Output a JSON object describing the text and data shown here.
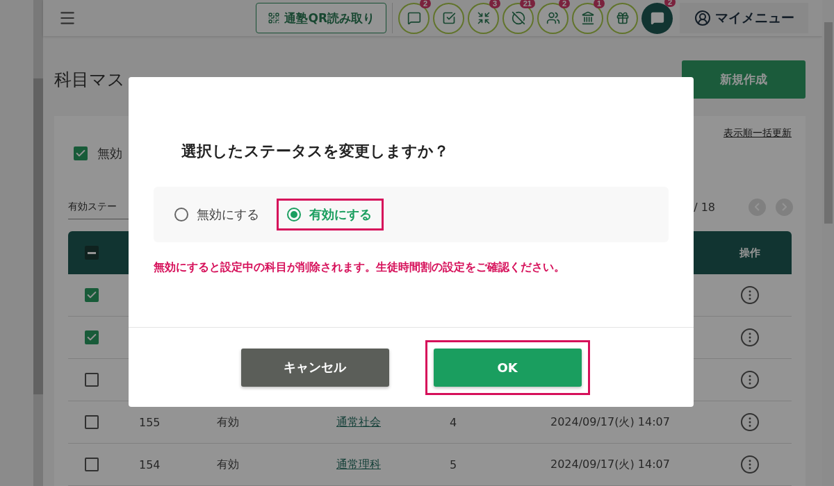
{
  "header": {
    "qr_button": "通塾QR読み取り",
    "icons": [
      {
        "badge": "2",
        "active": false
      },
      {
        "active": false
      },
      {
        "badge": "3",
        "active": false
      },
      {
        "badge": "21",
        "active": false
      },
      {
        "badge": "2",
        "active": false
      },
      {
        "badge": "1",
        "active": false
      },
      {
        "active": false
      },
      {
        "badge": "2",
        "active": true
      }
    ],
    "my_menu": "マイメニュー"
  },
  "page": {
    "title": "科目マス",
    "new_button": "新規作成"
  },
  "card": {
    "filter_checkbox": {
      "label": "無効",
      "checked": true
    },
    "filter_select": "有効ステー",
    "bulk_link": "表示順一括更新",
    "page_count": "/ 18",
    "table": {
      "header_checkbox_indeterminate": true,
      "columns": [
        "操作"
      ],
      "rows": [
        {
          "checked": true
        },
        {
          "checked": true
        },
        {
          "checked": false
        },
        {
          "checked": false,
          "id": "155",
          "status": "有効",
          "subject": "通常社会",
          "order": "4",
          "updated": "2024/09/17(火) 14:07"
        },
        {
          "checked": false,
          "id": "154",
          "status": "有効",
          "subject": "通常理科",
          "order": "5",
          "updated": "2024/09/17(火) 14:07"
        }
      ]
    }
  },
  "dialog": {
    "title": "選択したステータスを変更しますか？",
    "options": [
      {
        "label": "無効にする",
        "selected": false,
        "highlighted": false
      },
      {
        "label": "有効にする",
        "selected": true,
        "highlighted": true
      }
    ],
    "warning": "無効にすると設定中の科目が削除されます。生徒時間割の設定をご確認ください。",
    "cancel_button": {
      "label": "キャンセル",
      "highlighted": false
    },
    "ok_button": {
      "label": "OK",
      "highlighted": true
    }
  }
}
